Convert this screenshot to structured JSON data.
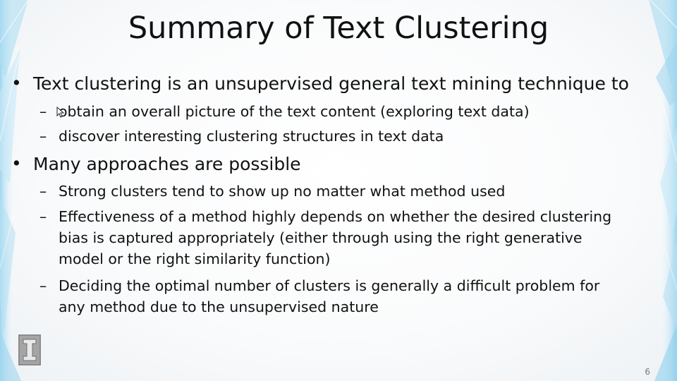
{
  "slide": {
    "title": "Summary of Text Clustering",
    "bullet_symbol": "•",
    "dash_symbol": "–",
    "bullets": [
      {
        "text": "Text clustering is an unsupervised general text mining technique to",
        "subs": [
          {
            "lines": [
              "obtain an overall picture of the text content (exploring text data)"
            ]
          },
          {
            "lines": [
              "discover interesting clustering structures in text data"
            ]
          }
        ]
      },
      {
        "text": "Many approaches are possible",
        "subs": [
          {
            "lines": [
              "Strong clusters tend to show up no matter what method used"
            ]
          },
          {
            "lines": [
              "Effectiveness of a method highly depends on whether the desired clustering",
              "bias is captured appropriately (either through using the right generative",
              "model or the right similarity function)"
            ]
          },
          {
            "lines": [
              "Deciding the optimal number of clusters is generally a difficult problem for",
              "any method due to the unsupervised nature"
            ]
          }
        ]
      }
    ],
    "page_number": "6"
  },
  "colors": {
    "text": "#111111",
    "deco_blue": "#7fc6e8",
    "logo_gray": "#8c8c8c"
  },
  "icons": {
    "logo": "university-block-i-logo",
    "cursor": "mouse-pointer-icon"
  }
}
